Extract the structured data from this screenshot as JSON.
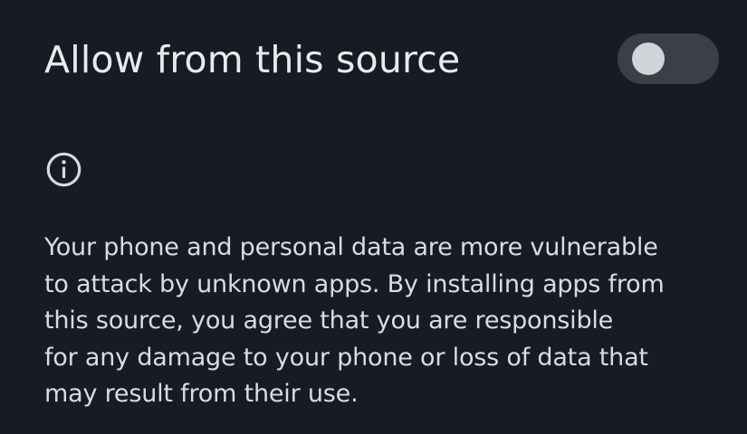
{
  "setting": {
    "title": "Allow from this source",
    "toggle_state": "off"
  },
  "info": {
    "icon": "info-icon",
    "warning_text": "Your phone and personal data are more vulnerable\nto attack by unknown apps. By installing apps from\nthis source, you agree that you are responsible\nfor any damage to your phone or loss of data that\nmay result from their use."
  },
  "colors": {
    "background": "#171c22",
    "text": "#e8eaee",
    "toggle_track": "#3a4046",
    "toggle_thumb": "#d1d5d9"
  }
}
